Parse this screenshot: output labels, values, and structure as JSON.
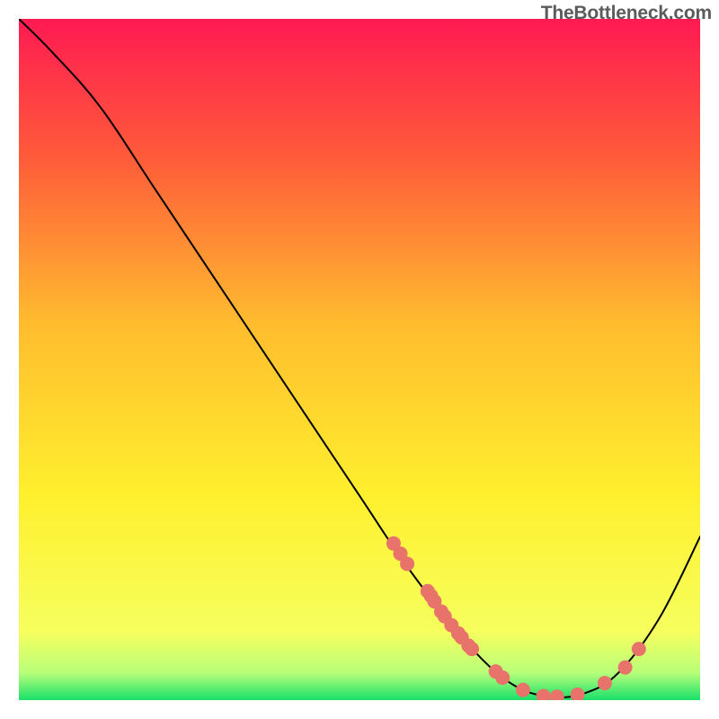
{
  "watermark": "TheBottleneck.com",
  "chart_data": {
    "type": "line",
    "title": "",
    "xlabel": "",
    "ylabel": "",
    "xlim": [
      0,
      100
    ],
    "ylim": [
      0,
      100
    ],
    "background_gradient": {
      "stops": [
        {
          "offset": 0,
          "color": "#ff1a52"
        },
        {
          "offset": 20,
          "color": "#ff5a3a"
        },
        {
          "offset": 45,
          "color": "#ffbd2e"
        },
        {
          "offset": 70,
          "color": "#fff02e"
        },
        {
          "offset": 90,
          "color": "#f6ff5e"
        },
        {
          "offset": 96,
          "color": "#b8ff7a"
        },
        {
          "offset": 100,
          "color": "#18e06a"
        }
      ]
    },
    "series": [
      {
        "name": "bottleneck-curve",
        "color": "#000000",
        "stroke_width": 2,
        "points": [
          {
            "x": 0,
            "y": 100
          },
          {
            "x": 5,
            "y": 95
          },
          {
            "x": 12,
            "y": 87
          },
          {
            "x": 20,
            "y": 75
          },
          {
            "x": 30,
            "y": 60
          },
          {
            "x": 40,
            "y": 45
          },
          {
            "x": 50,
            "y": 30
          },
          {
            "x": 56,
            "y": 21
          },
          {
            "x": 62,
            "y": 13
          },
          {
            "x": 68,
            "y": 6
          },
          {
            "x": 73,
            "y": 2
          },
          {
            "x": 78,
            "y": 0.5
          },
          {
            "x": 83,
            "y": 1
          },
          {
            "x": 88,
            "y": 4
          },
          {
            "x": 94,
            "y": 12
          },
          {
            "x": 100,
            "y": 24
          }
        ]
      }
    ],
    "scatter_points": {
      "name": "sample-markers",
      "color": "#e7736b",
      "radius": 8,
      "points": [
        {
          "x": 55,
          "y": 23
        },
        {
          "x": 56,
          "y": 21.5
        },
        {
          "x": 57,
          "y": 20
        },
        {
          "x": 60,
          "y": 16
        },
        {
          "x": 60.5,
          "y": 15.3
        },
        {
          "x": 61,
          "y": 14.5
        },
        {
          "x": 62,
          "y": 13
        },
        {
          "x": 62.5,
          "y": 12.3
        },
        {
          "x": 63.5,
          "y": 11
        },
        {
          "x": 64.5,
          "y": 9.8
        },
        {
          "x": 65,
          "y": 9.2
        },
        {
          "x": 66,
          "y": 8
        },
        {
          "x": 66.5,
          "y": 7.5
        },
        {
          "x": 70,
          "y": 4.2
        },
        {
          "x": 71,
          "y": 3.3
        },
        {
          "x": 74,
          "y": 1.5
        },
        {
          "x": 77,
          "y": 0.6
        },
        {
          "x": 79,
          "y": 0.5
        },
        {
          "x": 82,
          "y": 0.8
        },
        {
          "x": 86,
          "y": 2.5
        },
        {
          "x": 89,
          "y": 4.8
        },
        {
          "x": 91,
          "y": 7.5
        }
      ]
    }
  }
}
